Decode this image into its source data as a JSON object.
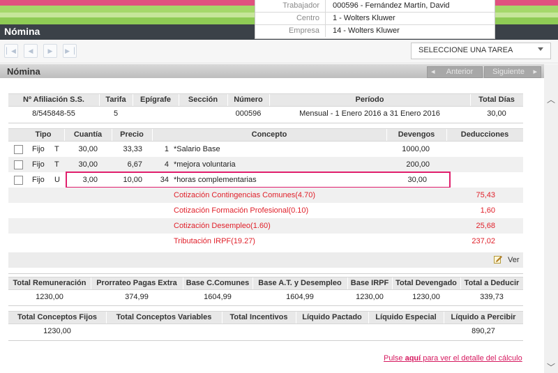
{
  "app": {
    "title": "Nómina"
  },
  "worker_info": [
    {
      "label": "Trabajador",
      "value": "000596 - Fernández Martín, David"
    },
    {
      "label": "Centro",
      "value": "1 - Wolters Kluwer"
    },
    {
      "label": "Empresa",
      "value": "14 - Wolters Kluwer"
    }
  ],
  "toolbar": {
    "task_select": "SELECCIONE UNA TAREA"
  },
  "section": {
    "title": "Nómina",
    "prev_label": "Anterior",
    "next_label": "Siguiente"
  },
  "summary_table": {
    "headers": [
      "Nº Afiliación S.S.",
      "Tarifa",
      "Epígrafe",
      "Sección",
      "Número",
      "Período",
      "Total Días"
    ],
    "row": [
      "8/545848-55",
      "5",
      "",
      "",
      "000596",
      "Mensual - 1 Enero 2016 a 31 Enero 2016",
      "30,00"
    ]
  },
  "concepts_table": {
    "headers": [
      "Tipo",
      "Cuantía",
      "Precio",
      "Concepto",
      "Devengos",
      "Deducciones"
    ],
    "rows": [
      {
        "tipo": "Fijo",
        "clase": "T",
        "cuantia": "30,00",
        "precio": "33,33",
        "codigo": "1",
        "concepto": "*Salario Base",
        "devengos": "1000,00",
        "deducciones": ""
      },
      {
        "tipo": "Fijo",
        "clase": "T",
        "cuantia": "30,00",
        "precio": "6,67",
        "codigo": "4",
        "concepto": "*mejora voluntaria",
        "devengos": "200,00",
        "deducciones": ""
      },
      {
        "tipo": "Fijo",
        "clase": "U",
        "cuantia": "3,00",
        "precio": "10,00",
        "codigo": "34",
        "concepto": "*horas complementarias",
        "devengos": "30,00",
        "deducciones": ""
      }
    ],
    "deductions": [
      {
        "concepto": "Cotización Contingencias Comunes(4.70)",
        "importe": "75,43"
      },
      {
        "concepto": "Cotización Formación Profesional(0.10)",
        "importe": "1,60"
      },
      {
        "concepto": "Cotización Desempleo(1.60)",
        "importe": "25,68"
      },
      {
        "concepto": "Tributación IRPF(19.27)",
        "importe": "237,02"
      }
    ],
    "ver_label": "Ver"
  },
  "totals_table": {
    "headers": [
      "Total Remuneración",
      "Prorrateo Pagas Extra",
      "Base C.Comunes",
      "Base A.T. y Desempleo",
      "Base IRPF",
      "Total Devengado",
      "Total a Deducir"
    ],
    "row": [
      "1230,00",
      "374,99",
      "1604,99",
      "1604,99",
      "1230,00",
      "1230,00",
      "339,73"
    ]
  },
  "net_table": {
    "headers": [
      "Total Conceptos Fijos",
      "Total Conceptos Variables",
      "Total Incentivos",
      "Líquido Pactado",
      "Líquido Especial",
      "Líquido a Percibir"
    ],
    "row": [
      "1230,00",
      "",
      "",
      "",
      "",
      "890,27"
    ]
  },
  "footer": {
    "link_pre": "Pulse ",
    "link_bold": "aquí",
    "link_post": " para ver el detalle del cálculo"
  },
  "colors": {
    "pink": "#e0527f",
    "green": "#8fcb55",
    "header_dark": "#3b4148",
    "deduction_red": "#e0202a",
    "highlight": "#e01e6c",
    "link": "#d6195f"
  },
  "icons": {
    "first": "first-page-icon",
    "prev": "previous-page-icon",
    "next": "next-page-icon",
    "last": "last-page-icon",
    "edit": "edit-note-icon"
  }
}
